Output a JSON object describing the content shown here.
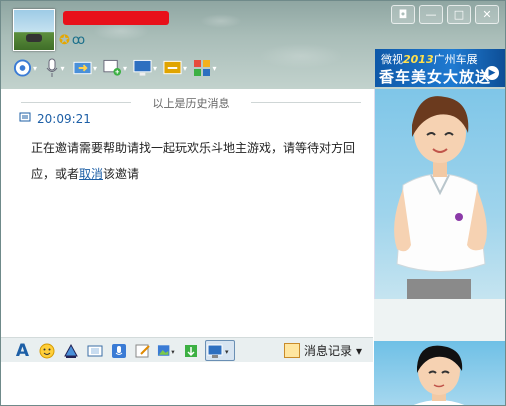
{
  "titlebar": {
    "window_buttons": [
      "◘",
      "—",
      "□",
      "✕"
    ]
  },
  "toolbar": {
    "items": [
      "video-icon",
      "voice-icon",
      "file-transfer-icon",
      "add-app-icon",
      "screen-share-icon",
      "remote-assist-icon",
      "apps-grid-icon"
    ]
  },
  "ad": {
    "line1_prefix": "微视",
    "line1_year": "2013",
    "line1_suffix": "广州车展",
    "line2": "香车美女大放送"
  },
  "chat": {
    "history_divider": "以上是历史消息",
    "message": {
      "time": "20:09:21",
      "text_before": "正在邀请需要帮助请找一起玩欢乐斗地主游戏，请等待对方回应，或者",
      "link": "取消",
      "text_after": "该邀请"
    }
  },
  "inputbar": {
    "items": [
      "font-icon",
      "emoji-icon",
      "bell-shake-icon",
      "snapshot-icon",
      "voice-msg-icon",
      "edit-icon",
      "image-icon",
      "gift-icon",
      "screenshot-icon"
    ],
    "message_log_label": "消息记录",
    "message_log_arrow": "▾"
  },
  "colors": {
    "accent": "#1d5fa6",
    "title_bg": "#a9bdb8",
    "redaction": "#e8101a"
  }
}
